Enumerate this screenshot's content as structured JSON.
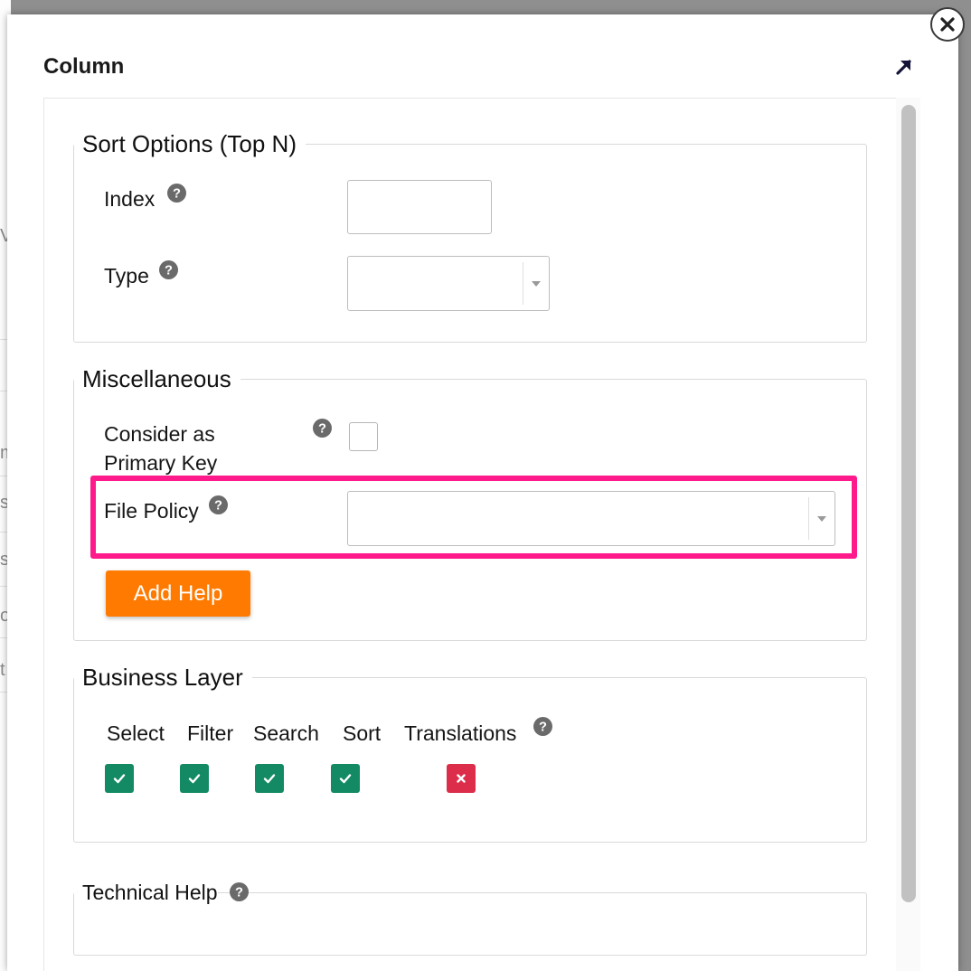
{
  "backdrop": {
    "fragments": [
      "V",
      "m",
      "s",
      "s",
      "o",
      "t"
    ]
  },
  "modal": {
    "title": "Column"
  },
  "sort_options": {
    "legend": "Sort Options (Top N)",
    "index_label": "Index",
    "index_value": "",
    "type_label": "Type",
    "type_value": ""
  },
  "miscellaneous": {
    "legend": "Miscellaneous",
    "primary_key_label_line1": "Consider as",
    "primary_key_label_line2": "Primary Key",
    "primary_key_checked": false,
    "file_policy_label": "File Policy",
    "file_policy_value": "",
    "add_help_label": "Add Help"
  },
  "business_layer": {
    "legend": "Business Layer",
    "columns": [
      {
        "label": "Select",
        "enabled": true
      },
      {
        "label": "Filter",
        "enabled": true
      },
      {
        "label": "Search",
        "enabled": true
      },
      {
        "label": "Sort",
        "enabled": true
      },
      {
        "label": "Translations",
        "enabled": false
      }
    ]
  },
  "technical_help": {
    "legend": "Technical Help"
  },
  "colors": {
    "highlight": "#ff1a8c",
    "add_help_button": "#ff7a00",
    "enabled_badge": "#138a63",
    "disabled_badge": "#dc2d4a"
  },
  "icons": {
    "help": "question-circle-icon",
    "expand": "arrow-up-right-icon",
    "close": "close-icon",
    "enabled": "check-icon",
    "disabled": "x-icon"
  }
}
